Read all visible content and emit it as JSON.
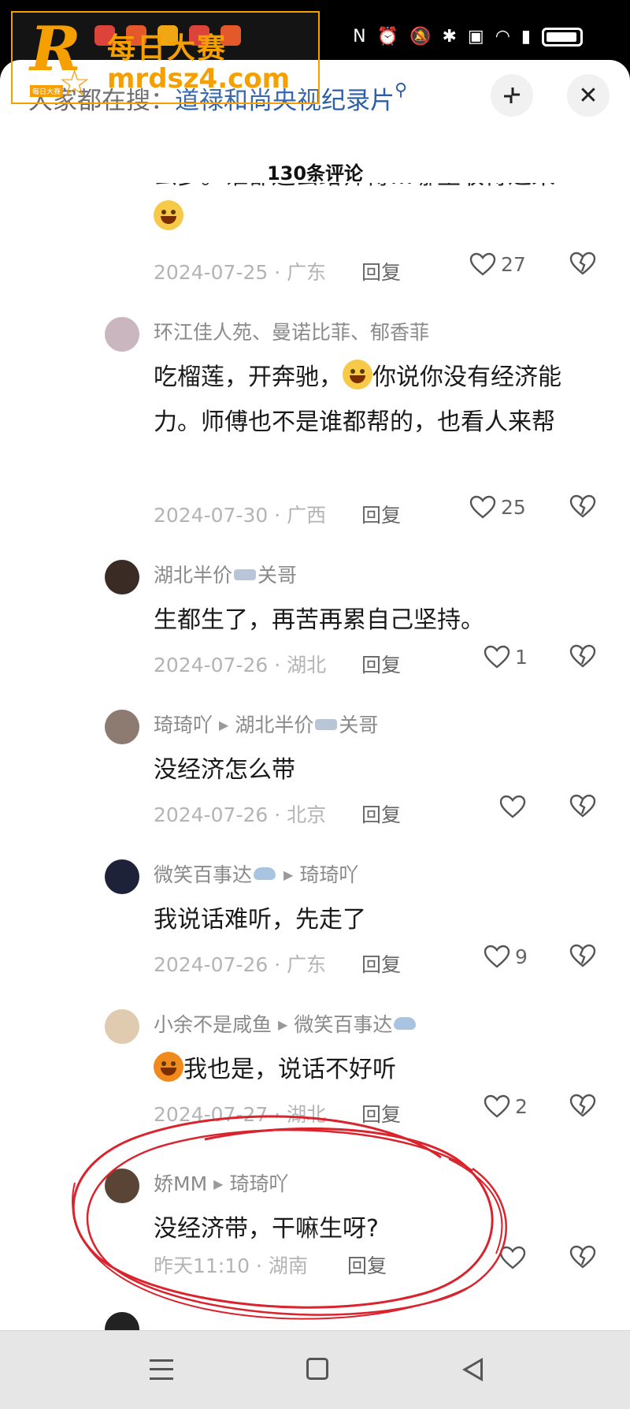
{
  "watermark": {
    "logo_letter": "R",
    "logo_mini": "每日大赛",
    "title": "每日大赛",
    "url": "mrdsz4.com"
  },
  "search_bar": {
    "prefix": "大家都在搜：",
    "query": "道禄和尚央视纪录片",
    "icon": "search-icon"
  },
  "header": {
    "comment_count": "130条评论",
    "collapse_icon": "collapse-icon",
    "close_icon": "close-icon"
  },
  "reply_label": "回复",
  "fragment": {
    "text": "么多。谁都还去给师傅…哪里收得过来",
    "meta": "2024-07-25 · 广东",
    "likes": "27"
  },
  "comments": [
    {
      "names": "环江佳人苑、曼诺比菲、郁香菲",
      "text": "吃榴莲，开奔驰，你说你没有经济能力。师傅也不是谁都帮的，也看人来帮",
      "meta": "2024-07-30 · 广西",
      "likes": "25",
      "avatar_color": "#c9b6be"
    },
    {
      "name": "湖北半价",
      "name_suffix": "关哥",
      "text": "生都生了，再苦再累自己坚持。",
      "meta": "2024-07-26 · 湖北",
      "likes": "1",
      "avatar_color": "#3a2c25"
    },
    {
      "name": "琦琦吖",
      "reply_to": "湖北半价",
      "reply_to_suffix": "关哥",
      "text": "没经济怎么带",
      "meta": "2024-07-26 · 北京",
      "likes": "",
      "avatar_color": "#8d7a70"
    },
    {
      "name": "微笑百事达",
      "reply_to": "琦琦吖",
      "text": "我说话难听，先走了",
      "meta": "2024-07-26 · 广东",
      "likes": "9",
      "avatar_color": "#1d2238"
    },
    {
      "name": "小余不是咸鱼",
      "reply_to": "微笑百事达",
      "text": "我也是，说话不好听",
      "meta": "2024-07-27 · 湖北",
      "likes": "2",
      "avatar_color": "#e0cbb0"
    },
    {
      "name": "娇MM",
      "reply_to": "琦琦吖",
      "text": "没经济带，干嘛生呀?",
      "meta": "昨天11:10 · 湖南",
      "likes": "",
      "avatar_color": "#5a4436"
    }
  ],
  "colors": {
    "watermark_orange": "#f5a000",
    "link_blue": "#2b5fa8",
    "annotation_red": "#d9232d"
  },
  "navbar": {
    "menu_icon": "menu-icon",
    "home_icon": "home-icon",
    "back_icon": "back-icon"
  }
}
